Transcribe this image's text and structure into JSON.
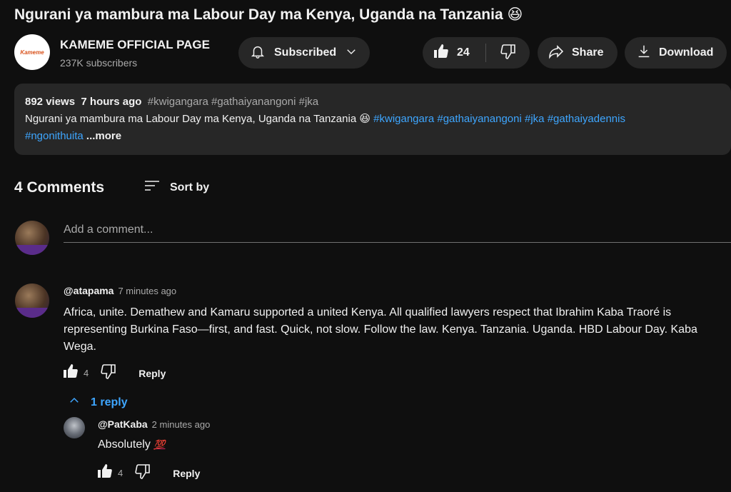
{
  "video": {
    "title": "Ngurani ya mambura ma Labour Day ma Kenya, Uganda na Tanzania 😆"
  },
  "channel": {
    "name": "KAMEME OFFICIAL PAGE",
    "subscribers": "237K subscribers",
    "logo_text": "Kameme"
  },
  "actions": {
    "subscribe_label": "Subscribed",
    "like_count": "24",
    "share_label": "Share",
    "download_label": "Download"
  },
  "description": {
    "views": "892 views",
    "age": "7 hours ago",
    "top_tags": "#kwigangara #gathaiyanangoni #jka",
    "text": "Ngurani ya mambura ma Labour Day ma Kenya, Uganda na Tanzania 😆",
    "tags": [
      "#kwigangara",
      "#gathaiyanangoni",
      "#jka",
      "#gathaiyadennis",
      "#ngonithuita"
    ],
    "more_label": "...more"
  },
  "comments": {
    "count_label": "4 Comments",
    "sort_label": "Sort by",
    "add_placeholder": "Add a comment...",
    "items": [
      {
        "author": "@atapama",
        "time": "7 minutes ago",
        "text": "Africa, unite. Demathew and Kamaru supported a united Kenya. All qualified lawyers respect that Ibrahim Kaba Traoré is representing Burkina Faso—first, and fast. Quick, not slow. Follow the law. Kenya. Tanzania. Uganda. HBD Labour Day. Kaba Wega.",
        "likes": "4",
        "reply_label": "Reply",
        "replies_label": "1 reply",
        "replies": [
          {
            "author": "@PatKaba",
            "time": "2 minutes ago",
            "text": "Absolutely",
            "emoji": "💯",
            "likes": "4",
            "reply_label": "Reply"
          }
        ]
      }
    ]
  },
  "colors": {
    "background": "#0f0f0f",
    "pill": "#272727",
    "link": "#3ea6ff",
    "muted": "#aaaaaa"
  }
}
